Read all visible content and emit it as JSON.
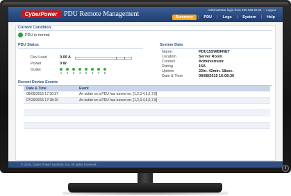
{
  "header": {
    "logo_text": "CyberPower",
    "app_title": "PDU Remote Management",
    "login_info": "Administrator login from 192.168.20.21",
    "logout_label": "Logout",
    "nav": [
      {
        "label": "Summary",
        "active": true
      },
      {
        "label": "PDU",
        "active": false
      },
      {
        "label": "Logs",
        "active": false
      },
      {
        "label": "System",
        "active": false
      },
      {
        "label": "Help",
        "active": false
      }
    ]
  },
  "current_condition": {
    "title": "Current Condition",
    "status_text": "PDU is normal",
    "status_color": "#2a9d3a"
  },
  "pdu_status": {
    "title": "PDU Status",
    "dev_load_label": "Dev Load",
    "dev_load_value": "0.00 A",
    "dev_load_fraction": 0.0,
    "power_label": "Power",
    "power_value": "0 W",
    "outlet_label": "Outlet",
    "outlets": [
      "1",
      "2",
      "3",
      "4",
      "5",
      "6",
      "7",
      "8"
    ],
    "outlet_color": "#35a845"
  },
  "system_data": {
    "title": "System Data",
    "rows": [
      {
        "label": "Name",
        "value": "PDU15SWBFNET"
      },
      {
        "label": "Location",
        "value": "Server Room"
      },
      {
        "label": "Contact",
        "value": "Administrator"
      },
      {
        "label": "Rating",
        "value": "15A"
      },
      {
        "label": "Uptime",
        "value": "22hr. 42min. 18sec."
      },
      {
        "label": "Date & Time",
        "value": "08/08/2015 16:08:30"
      }
    ]
  },
  "recent_events": {
    "title": "Recent Device Events",
    "columns": [
      "Date & Time",
      "Event"
    ],
    "rows": [
      [
        "08/05/2015 17:30:37",
        "An outlet on a PDU has turned on. [1,2,3,4,5,6,7,8]"
      ],
      [
        "07/29/2015 17:38:16",
        "An outlet on a PDU has turned on. [1,2,3,4,5,6,7,8]"
      ]
    ]
  },
  "footer_text": "© 2015, Cyber Power Systems, Inc. All rights reserved.",
  "colors": {
    "header_blue": "#1f3d70",
    "accent_orange": "#f5a623",
    "logo_red": "#c41a1a"
  }
}
